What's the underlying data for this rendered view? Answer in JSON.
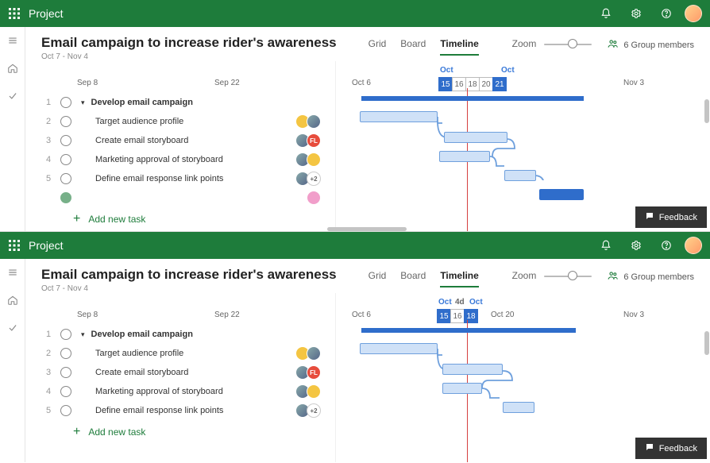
{
  "app_title": "Project",
  "project": {
    "title": "Email campaign to increase rider's awareness",
    "dates": "Oct 7 - Nov 4"
  },
  "tabs": {
    "grid": "Grid",
    "board": "Board",
    "timeline": "Timeline"
  },
  "zoom_label": "Zoom",
  "members_label": "6 Group members",
  "grid_dates": {
    "sep8": "Sep 8",
    "sep22": "Sep 22"
  },
  "timeline_header_a": {
    "oct6": "Oct 6",
    "nov3": "Nov 3",
    "top_left": "Oct",
    "top_right": "Oct",
    "cells": [
      "15",
      "16",
      "18",
      "20",
      "21"
    ]
  },
  "timeline_header_b": {
    "oct6": "Oct 6",
    "oct20": "Oct 20",
    "nov3": "Nov 3",
    "top_left": "Oct",
    "top_mid": "4d",
    "top_right": "Oct",
    "cells": [
      "15",
      "16",
      "18"
    ]
  },
  "tasks": [
    {
      "num": "1",
      "name": "Develop email campaign",
      "summary": true
    },
    {
      "num": "2",
      "name": "Target audience profile"
    },
    {
      "num": "3",
      "name": "Create email storyboard"
    },
    {
      "num": "4",
      "name": "Marketing approval of storyboard"
    },
    {
      "num": "5",
      "name": "Define email response link points"
    }
  ],
  "more_count": "+2",
  "add_task": "Add new task",
  "feedback": "Feedback"
}
